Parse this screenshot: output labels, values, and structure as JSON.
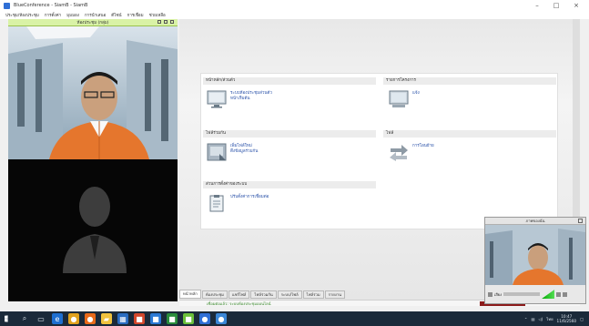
{
  "window": {
    "title": "BlueConference - SiamB - SiamB",
    "controls": {
      "minimize": "–",
      "maximize": "□",
      "close": "×"
    }
  },
  "menu": [
    "ประชุม/ห้องประชุม",
    "การตั้งค่า",
    "มุมมอง",
    "การนำเสนอ",
    "ดีไซน์",
    "การเชื่อม",
    "ช่วยเหลือ"
  ],
  "left_panel": {
    "title": "ห้องประชุม (กลุ่ม)"
  },
  "dashboard": {
    "sections": {
      "home": "หน้าหลัก/ส่วนตัว",
      "projects": "รายการโครงการ",
      "share": "ไฟล์ร่วมกัน",
      "files": "ไฟล์",
      "settings": "ส่วนการตั้งค่าของระบบ"
    },
    "tiles": {
      "monitor_title": "ระบบห้องประชุมส่วนตัว",
      "monitor_sub": "หน้าเริ่มต้น",
      "project": "แจ้ง",
      "share_title": "เพิ่มไฟล์ใหม่",
      "share_sub": "ดึงข้อมูลร่วมกัน",
      "transfer": "การโอนย้าย",
      "settings": "ปรับตั้งค่าการเชื่อมต่อ"
    }
  },
  "tabs": [
    "หน้าหลัก",
    "ห้องประชุม",
    "แชร์ไฟล์",
    "ไฟล์ร่วมกัน",
    "ระบบ/ไฟล์",
    "ไฟล์ร่วม",
    "รายงาน"
  ],
  "status": {
    "text": "เชื่อมต่อแล้ว: ระบบห้องประชุมออนไลน์"
  },
  "self_view": {
    "title": "ภาพของฉัน",
    "slider_label": "เสียง"
  },
  "taskbar": {
    "icons": [
      "search-icon",
      "task-view-icon",
      "edge-icon",
      "chrome-icon",
      "firefox-icon",
      "explorer-icon",
      "store-icon",
      "settings-icon",
      "app-icon",
      "app-icon",
      "app-icon",
      "app-icon",
      "app-icon",
      "app-icon"
    ],
    "tray_text": "ไทย",
    "time": "10:47",
    "date": "11/6/2560"
  },
  "colors": {
    "accent": "#2f6fd6",
    "status_green": "#3a8a2c",
    "left_head": "#d9f2a6",
    "taskbar": "#1b2a3a"
  }
}
